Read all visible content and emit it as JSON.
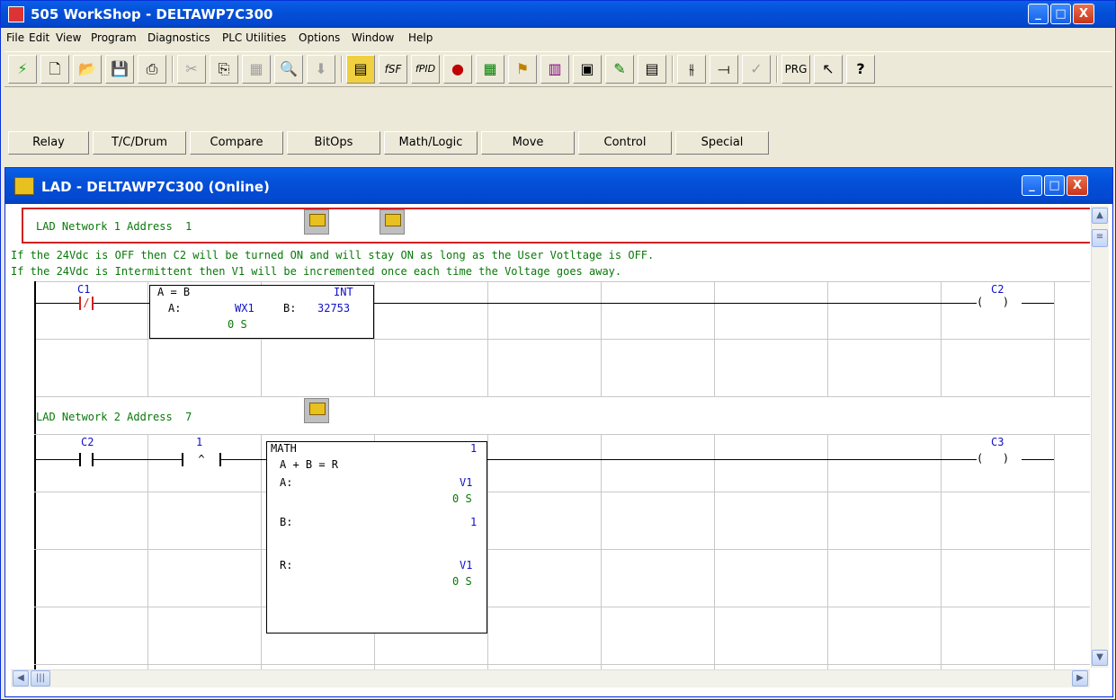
{
  "window": {
    "title": "505 WorkShop - DELTAWP7C300",
    "minimize": "_",
    "maximize": "□",
    "close": "X"
  },
  "menu": [
    "File",
    "Edit",
    "View",
    "Program",
    "Diagnostics",
    "PLC Utilities",
    "Options",
    "Window",
    "Help"
  ],
  "toolbar": {
    "buttons": [
      "lightning",
      "new",
      "open",
      "save",
      "print",
      "cut",
      "copy",
      "paste",
      "find",
      "down",
      "ladder",
      "fsf",
      "fpid",
      "status",
      "grid",
      "flag",
      "chart",
      "monitor",
      "wizard",
      "data",
      "contact",
      "coil",
      "check",
      "PRG",
      "pointer",
      "help"
    ],
    "fsf_label": "fSF",
    "fpid_label": "fPID",
    "prg_label": "PRG"
  },
  "instruction_tabs": [
    "Relay",
    "T/C/Drum",
    "Compare",
    "BitOps",
    "Math/Logic",
    "Move",
    "Control",
    "Special"
  ],
  "lad_window": {
    "title": "LAD - DELTAWP7C300 (Online)",
    "minimize": "_",
    "maximize": "□",
    "close": "X"
  },
  "network1": {
    "header": "LAD Network 1 Address  1",
    "comment1": "If the 24Vdc is OFF then C2 will be turned ON and will stay ON as long as the User Votltage is OFF.",
    "comment2": "If the 24Vdc is Intermittent then V1 will be incremented once each time the Voltage goes away.",
    "contact_label": "C1",
    "contact_symbol": "/",
    "compare_title": "A = B",
    "compare_type": "INT",
    "compare_a_label": "A:",
    "compare_a_value": "WX1",
    "compare_b_label": "B:",
    "compare_b_value": "32753",
    "compare_a_state": "0 S",
    "coil_label": "C2",
    "coil_symbol": "(   )"
  },
  "network2": {
    "header": "LAD Network 2 Address  7",
    "contact1_label": "C2",
    "contact2_label": "1",
    "contact2_symbol": "^",
    "math_title": "MATH",
    "math_num": "1",
    "math_expr": "A + B = R",
    "a_label": "A:",
    "a_value": "V1",
    "a_state": "0 S",
    "b_label": "B:",
    "b_value": "1",
    "r_label": "R:",
    "r_value": "V1",
    "r_state": "0 S",
    "coil_label": "C3",
    "coil_symbol": "(   )"
  }
}
